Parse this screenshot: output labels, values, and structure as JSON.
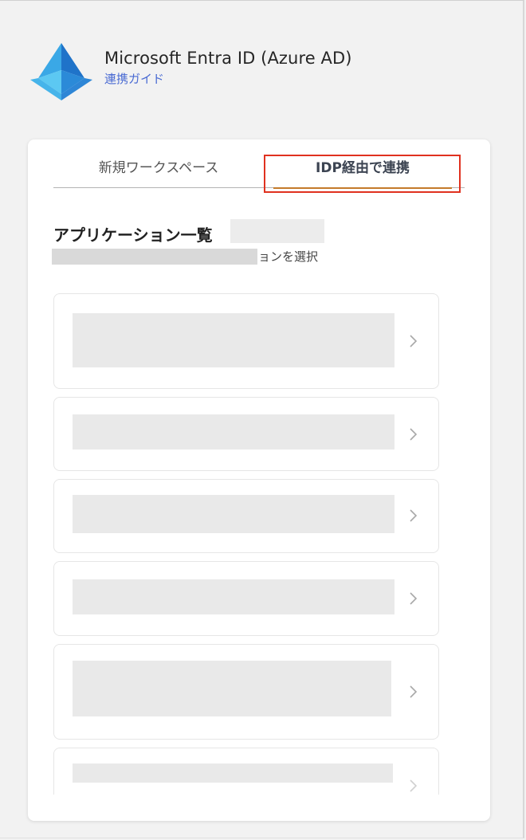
{
  "header": {
    "title": "Microsoft Entra ID (Azure AD)",
    "guide_link": "連携ガイド",
    "logo_icon": "azure-pyramid-icon"
  },
  "tabs": [
    {
      "label": "新規ワークスペース",
      "active": false
    },
    {
      "label": "IDP経由で連携",
      "active": true
    }
  ],
  "section": {
    "title": "アプリケーション一覧",
    "subtitle_visible": "ョンを選択"
  },
  "colors": {
    "link": "#4a6bd3",
    "tab_underline": "#c47a2a",
    "highlight_border": "#e0311f"
  },
  "applications_visible_count": 6
}
